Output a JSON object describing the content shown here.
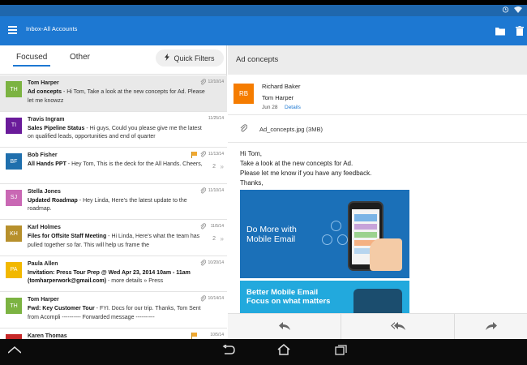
{
  "app": {
    "title": "Inbox-All Accounts",
    "accent": "#1d78d2"
  },
  "statusbar": {
    "icons": [
      "alarm-icon",
      "wifi-icon"
    ]
  },
  "tabs": [
    {
      "label": "Focused",
      "active": true
    },
    {
      "label": "Other",
      "active": false
    }
  ],
  "quick_filters": {
    "label": "Quick Filters",
    "icon": "bolt-icon"
  },
  "messages": [
    {
      "initials": "TH",
      "color": "#7cb342",
      "sender": "Tom Harper",
      "subject": "Ad concepts",
      "preview": " - Hi Tom, Take a look at the new concepts for Ad. Please let me knowzz",
      "date": "12/10/14",
      "attachment": true,
      "flag": false,
      "count": "",
      "selected": true
    },
    {
      "initials": "TI",
      "color": "#6a1b9a",
      "sender": "Travis Ingram",
      "subject": "Sales Pipeline Status",
      "preview": " - Hi guys, Could you please give me the latest on qualified leads, opportunities and end of quarter",
      "date": "11/25/14",
      "attachment": false,
      "flag": false,
      "count": "",
      "selected": false
    },
    {
      "initials": "BF",
      "color": "#1f6fad",
      "sender": "Bob Fisher",
      "subject": "All Hands PPT",
      "preview": " - Hey Tom, This is the deck for the All Hands. Cheers,",
      "date": "11/13/14",
      "attachment": true,
      "flag": true,
      "count": "2",
      "selected": false
    },
    {
      "initials": "SJ",
      "color": "#c968b4",
      "sender": "Stella Jones",
      "subject": "Updated Roadmap",
      "preview": " - Hey Linda, Here's the latest update to the roadmap.",
      "date": "11/10/14",
      "attachment": true,
      "flag": false,
      "count": "",
      "selected": false
    },
    {
      "initials": "KH",
      "color": "#b7902c",
      "sender": "Karl Holmes",
      "subject": "Files for Offsite Staff Meeting",
      "preview": " - Hi Linda, Here's what the team has pulled together so far. This will help us frame the",
      "date": "11/5/14",
      "attachment": true,
      "flag": false,
      "count": "2",
      "selected": false
    },
    {
      "initials": "PA",
      "color": "#f2b800",
      "sender": "Paula Allen",
      "subject": "Invitation: Press Tour Prep @ Wed Apr 23, 2014 10am - 11am (tomharperwork@gmail.com)",
      "preview": " - more details » Press",
      "date": "10/20/14",
      "attachment": true,
      "flag": false,
      "count": "",
      "selected": false
    },
    {
      "initials": "TH",
      "color": "#7cb342",
      "sender": "Tom Harper",
      "subject": "Fwd: Key Customer Tour",
      "preview": " - FYI. Docs for our trip. Thanks, Tom Sent from Acompli ---------- Forwarded message ----------",
      "date": "10/14/14",
      "attachment": true,
      "flag": false,
      "count": "",
      "selected": false
    },
    {
      "initials": "KT",
      "color": "#c62828",
      "sender": "Karen Thomas",
      "subject": "",
      "preview": "",
      "date": "10/5/14",
      "attachment": false,
      "flag": true,
      "count": "",
      "selected": false
    }
  ],
  "reading": {
    "subject": "Ad concepts",
    "from": "Richard Baker",
    "from_initials": "RB",
    "from_color": "#f57c00",
    "to": "Tom Harper",
    "date": "Jun 28",
    "details_label": "Details",
    "attachment": "Ad_concepts.jpg (3MB)",
    "body": [
      "Hi Tom,",
      "Take a look at the new concepts for Ad.",
      "Please let me know if you have any feedback.",
      "Thanks,"
    ],
    "promo1_line1": "Do More with",
    "promo1_line2": "Mobile Email",
    "promo2_line1": "Better Mobile Email",
    "promo2_line2": "Focus on what matters"
  },
  "actions": [
    "reply-icon",
    "reply-all-icon",
    "forward-icon"
  ],
  "nav": [
    "up-icon",
    "back-icon",
    "home-icon",
    "recents-icon"
  ]
}
